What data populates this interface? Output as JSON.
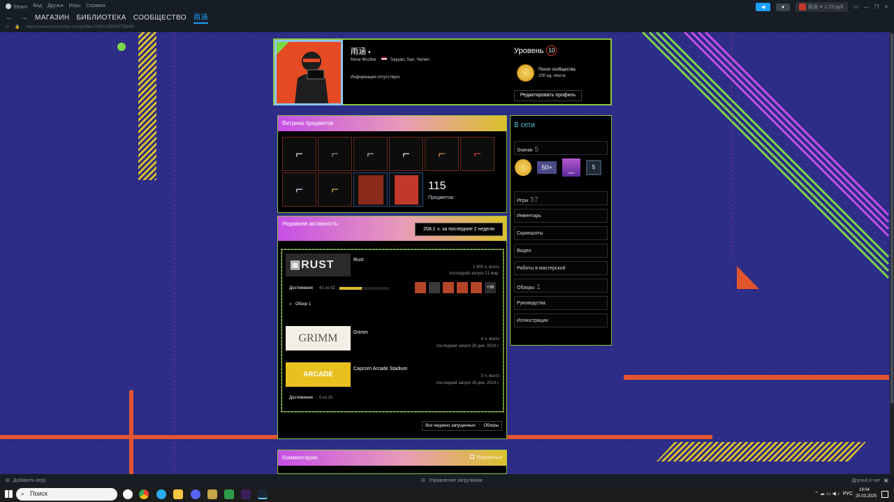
{
  "window": {
    "menu": [
      "Steam",
      "Вид",
      "Друзья",
      "Игры",
      "Справка"
    ],
    "nav": [
      "МАГАЗИН",
      "БИБЛИОТЕКА",
      "СООБЩЕСТВО",
      "雨涵"
    ],
    "url": "https://steamcommunity.com/profiles/76561199019795999/",
    "account_name": "雨涵",
    "balance": "1,73 руб."
  },
  "profile": {
    "name": "雨涵",
    "real_name": "Mose Mccline",
    "location": "Sayyan, San, Yemen",
    "summary": "Информация отсутствует.",
    "level_label": "Уровень",
    "level": "10",
    "badge_title": "Посол сообщества",
    "badge_xp": "200 ед. опыта",
    "edit_button": "Редактировать профиль"
  },
  "showcase": {
    "title": "Витрина предметов",
    "count": "115",
    "count_label": "Предметов",
    "items": [
      "weapon-ak-white",
      "weapon-ak-black",
      "weapon-ak-gray",
      "weapon-ak-white-2",
      "weapon-ak-orange",
      "weapon-ak-red",
      "weapon-ak-ice",
      "weapon-ak-gold",
      "sticker-red",
      "case-red"
    ]
  },
  "activity": {
    "title": "Недавняя активность",
    "hours": "208,1 ч. за последние 2 недели",
    "games": [
      {
        "name": "Rust",
        "total": "1 800 ч. всего",
        "last": "последний запуск 21 мар."
      },
      {
        "name": "Grimm",
        "total": "4 ч. всего",
        "last": "последний запуск 26 дек. 2024 г."
      },
      {
        "name": "Capcom Arcade Stadium",
        "total": "3 ч. всего",
        "last": "последний запуск 26 дек. 2024 г."
      }
    ],
    "ach_label": "Достижения",
    "rust_ach": "41 из 92",
    "rust_ach_progress": 0.45,
    "rust_ach_more": "+36",
    "review": "Обзор 1",
    "capcom_ach": "0 из 20",
    "link_recent": "Все недавно запущенные",
    "link_reviews": "Обзоры"
  },
  "comments": {
    "title": "Комментарии",
    "subscribe": "Подписаться"
  },
  "sidebar": {
    "status": "В сети",
    "badges_label": "Значки",
    "badges_count": "5",
    "badge_years": "50+",
    "badge_year": "2022",
    "badge_five": "5",
    "games_label": "Игры",
    "games_count": "57",
    "links": [
      "Инвентарь",
      "Скриншоты",
      "Видео",
      "Работы в мастерской"
    ],
    "reviews_label": "Обзоры",
    "reviews_count": "1",
    "links2": [
      "Руководства",
      "Иллюстрации"
    ]
  },
  "bottom": {
    "add_game": "Добавить игру",
    "downloads": "Управление загрузками",
    "friends": "Друзья и чат"
  },
  "taskbar": {
    "search": "Поиск",
    "lang": "РУС",
    "time": "19:04",
    "date": "25.03.2025"
  },
  "colors": {
    "bg": "#2d2c86",
    "accent": "#1a9fff",
    "green_border": "#8bc53f",
    "orange": "#e1552f"
  }
}
